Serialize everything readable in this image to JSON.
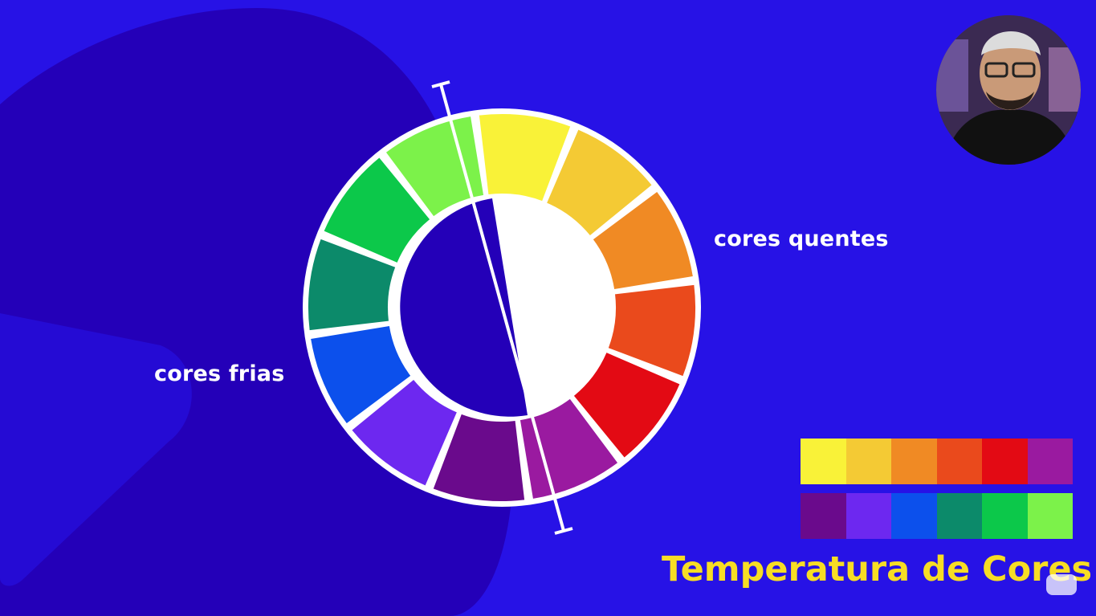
{
  "labels": {
    "warm": "cores quentes",
    "cool": "cores frias"
  },
  "title": "Temperatura de Cores",
  "colors": {
    "background": "#2712e6",
    "blob": "#2400b8",
    "title": "#f7dd24",
    "label": "#ffffff"
  },
  "wheel_segments": [
    "#f9f238",
    "#f4ca34",
    "#f08a24",
    "#ea4a1c",
    "#e30a14",
    "#9a1aa0",
    "#6a0a8c",
    "#6d28f0",
    "#0c50ec",
    "#0c8a6a",
    "#0cc84a",
    "#7cf24a"
  ],
  "swatches": {
    "warm": [
      "#f9f238",
      "#f4ca34",
      "#f08a24",
      "#ea4a1c",
      "#e30a14",
      "#9a1aa0"
    ],
    "cool": [
      "#6a0a8c",
      "#6d28f0",
      "#0c50ec",
      "#0c8a6a",
      "#0cc84a",
      "#7cf24a"
    ]
  },
  "presenter": {
    "icon": "presenter-webcam"
  },
  "logo": {
    "icon": "channel-logo-icon"
  }
}
